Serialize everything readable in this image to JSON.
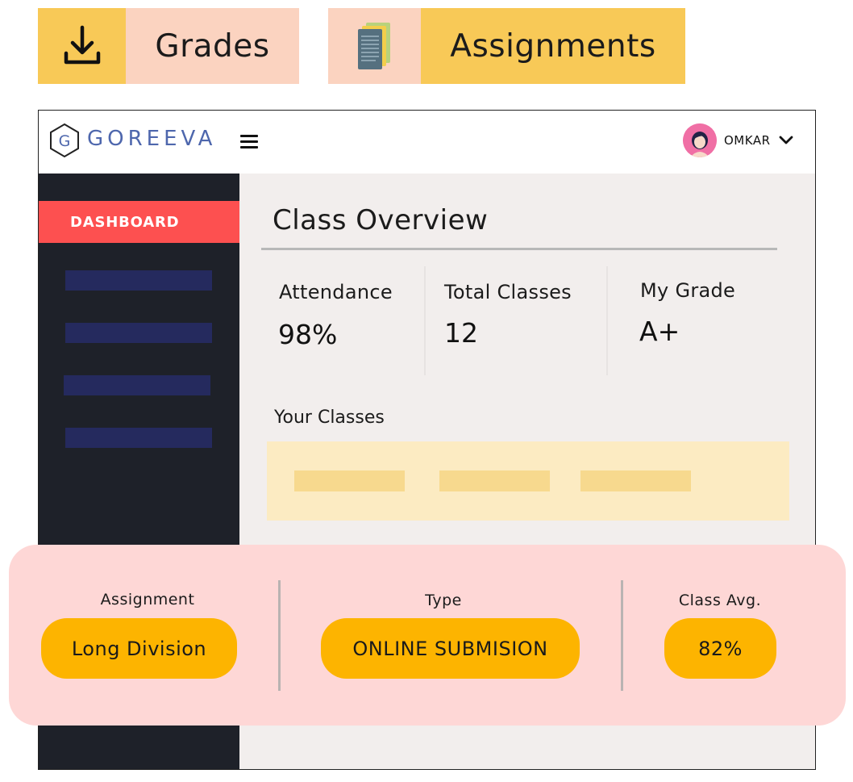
{
  "top_buttons": {
    "grades": {
      "label": "Grades",
      "icon": "download-icon"
    },
    "assignments": {
      "label": "Assignments",
      "icon": "documents-icon"
    }
  },
  "header": {
    "logo_text": "GOREEVA",
    "logo_letter": "G",
    "user_name": "OMKAR"
  },
  "sidebar": {
    "active_item": "DASHBOARD",
    "placeholder_items": 4
  },
  "overview": {
    "title": "Class Overview",
    "stats": [
      {
        "label": "Attendance",
        "value": "98%"
      },
      {
        "label": "Total Classes",
        "value": "12"
      },
      {
        "label": "My Grade",
        "value": "A+"
      }
    ],
    "classes_title": "Your Classes"
  },
  "assignment_card": {
    "columns": [
      {
        "label": "Assignment",
        "value": "Long Division"
      },
      {
        "label": "Type",
        "value": "ONLINE SUBMISION"
      },
      {
        "label": "Class Avg.",
        "value": "82%"
      }
    ]
  },
  "colors": {
    "accent_yellow": "#f8c957",
    "peach": "#fbd3c0",
    "sidebar_bg": "#1e2129",
    "dashboard_red": "#fd5050",
    "pill_yellow": "#fdb400",
    "card_pink": "#fed7d6",
    "logo_blue": "#4e67ad"
  }
}
